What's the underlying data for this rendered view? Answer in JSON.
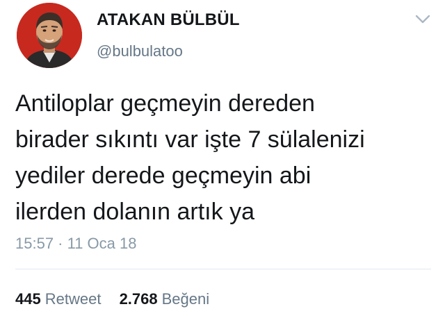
{
  "author": {
    "display_name": "ATAKAN BÜLBÜL",
    "handle": "@bulbulatoo"
  },
  "tweet": {
    "lines": [
      "Antiloplar geçmeyin dereden",
      "birader sıkıntı var işte 7 sülalenizi",
      "yediler derede geçmeyin abi",
      "ilerden dolanın artık ya"
    ],
    "timestamp": "15:57 · 11 Oca 18"
  },
  "stats": {
    "retweets": {
      "count": "445",
      "label": "Retweet"
    },
    "likes": {
      "count": "2.768",
      "label": "Beğeni"
    }
  },
  "icons": {
    "menu": "chevron-down-icon"
  },
  "colors": {
    "avatar_background": "#c7291f",
    "secondary_text": "#657786",
    "timestamp_text": "#8899a6",
    "divider": "#e1e8ed"
  }
}
